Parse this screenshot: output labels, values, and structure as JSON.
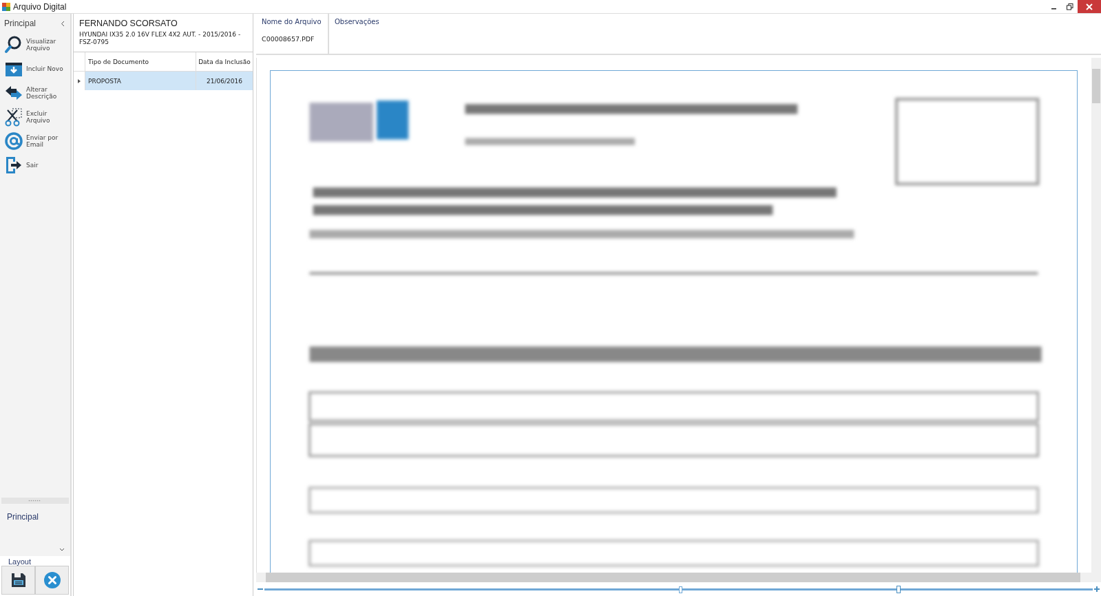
{
  "window": {
    "title": "Arquivo Digital"
  },
  "sidebar": {
    "header": "Principal",
    "items": [
      {
        "label": "Visualizar\nArquivo",
        "kind": "view"
      },
      {
        "label": "Incluir Novo",
        "kind": "add"
      },
      {
        "label": "Alterar\nDescrição",
        "kind": "edit"
      },
      {
        "label": "Excluir\nArquivo",
        "kind": "delete"
      },
      {
        "label": "Enviar por\nEmail",
        "kind": "email"
      },
      {
        "label": "Sair",
        "kind": "exit"
      }
    ],
    "group": "Principal",
    "layout_label": "Layout"
  },
  "client": {
    "name": "FERNANDO SCORSATO",
    "vehicle": "HYUNDAI IX35 2.0 16V FLEX 4X2 AUT. - 2015/2016 - FSZ-0795"
  },
  "table": {
    "columns": [
      "Tipo de Documento",
      "Data da Inclusão"
    ],
    "rows": [
      {
        "cells": [
          "PROPOSTA",
          "21/06/2016"
        ],
        "selected": true
      }
    ]
  },
  "file_info": {
    "name_label": "Nome do Arquivo",
    "name": "C00008657.PDF",
    "notes_label": "Observações"
  },
  "preview": {
    "kind": "picture",
    "zoom": {
      "level": 0.766
    }
  }
}
